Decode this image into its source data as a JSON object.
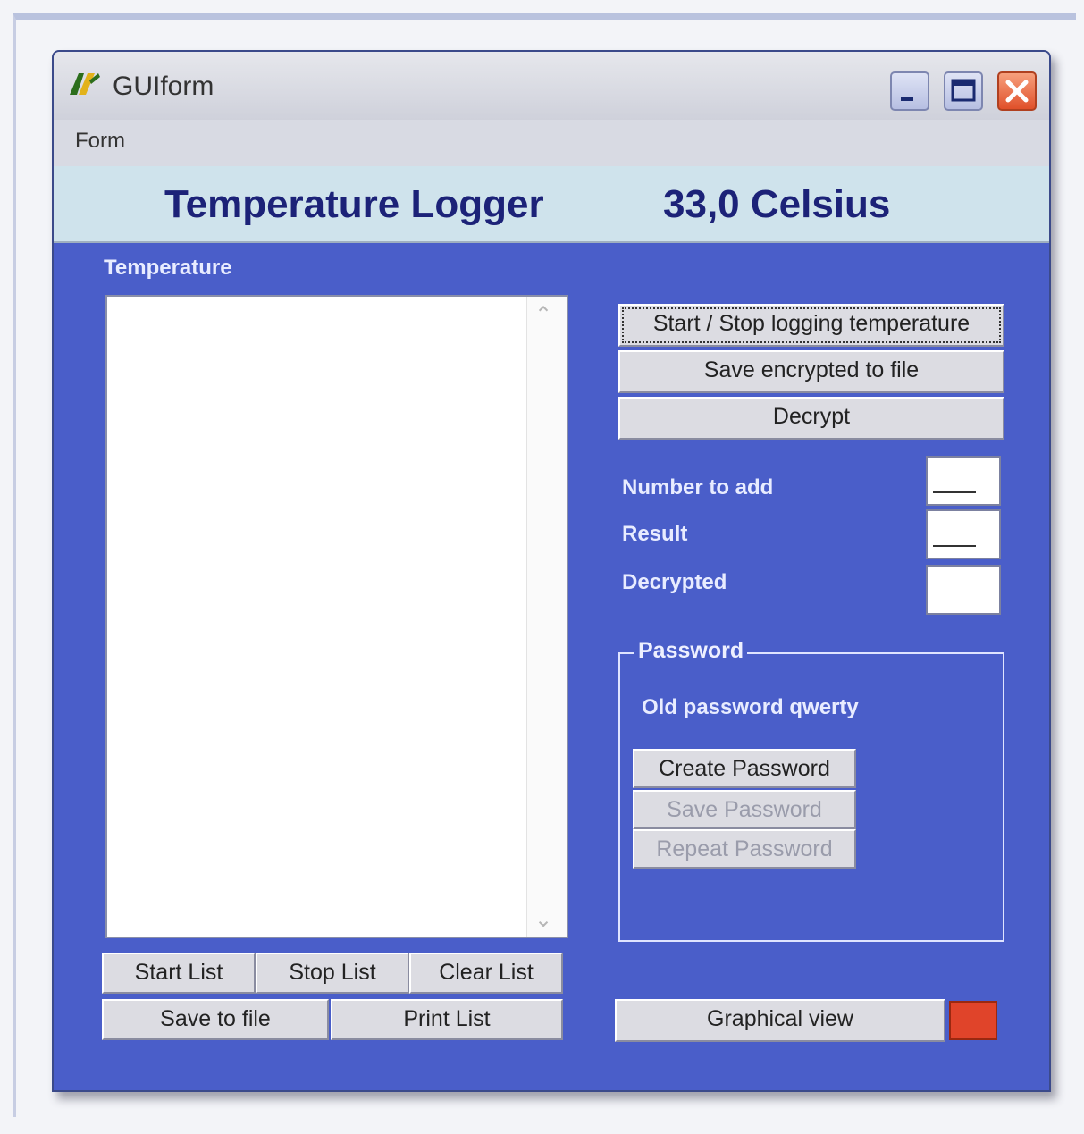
{
  "window": {
    "title": "GUIform"
  },
  "menu": {
    "items": [
      "Form"
    ]
  },
  "header": {
    "title": "Temperature Logger",
    "reading": "33,0 Celsius"
  },
  "temperature_panel": {
    "label": "Temperature",
    "list_items": []
  },
  "list_buttons": {
    "start": "Start List",
    "stop": "Stop List",
    "clear": "Clear List",
    "save": "Save to file",
    "print": "Print List"
  },
  "actions": {
    "start_stop": "Start / Stop logging temperature",
    "save_encrypted": "Save encrypted to file",
    "decrypt": "Decrypt"
  },
  "fields": {
    "number_to_add": {
      "label": "Number to add",
      "value": ""
    },
    "result": {
      "label": "Result",
      "value": ""
    },
    "decrypted": {
      "label": "Decrypted",
      "value": ""
    }
  },
  "password": {
    "legend": "Password",
    "old_password_text": "Old password qwerty",
    "create": "Create Password",
    "save": "Save Password",
    "repeat": "Repeat Password"
  },
  "graphical_view": "Graphical view",
  "colors": {
    "panel": "#4a5ec9",
    "header_band": "#cfe3ec",
    "header_text": "#1c2278",
    "indicator": "#e0442a"
  }
}
